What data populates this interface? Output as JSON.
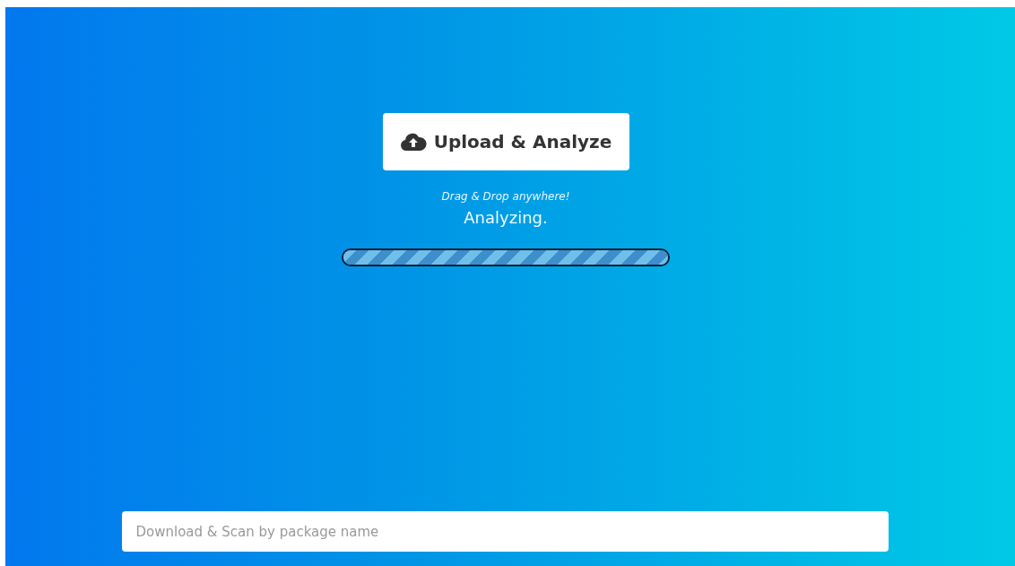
{
  "upload_button": {
    "label": "Upload & Analyze"
  },
  "hint": "Drag & Drop anywhere!",
  "status": "Analyzing.",
  "progress": {
    "level": 1
  },
  "package_search": {
    "placeholder": "Download & Scan by package name"
  }
}
